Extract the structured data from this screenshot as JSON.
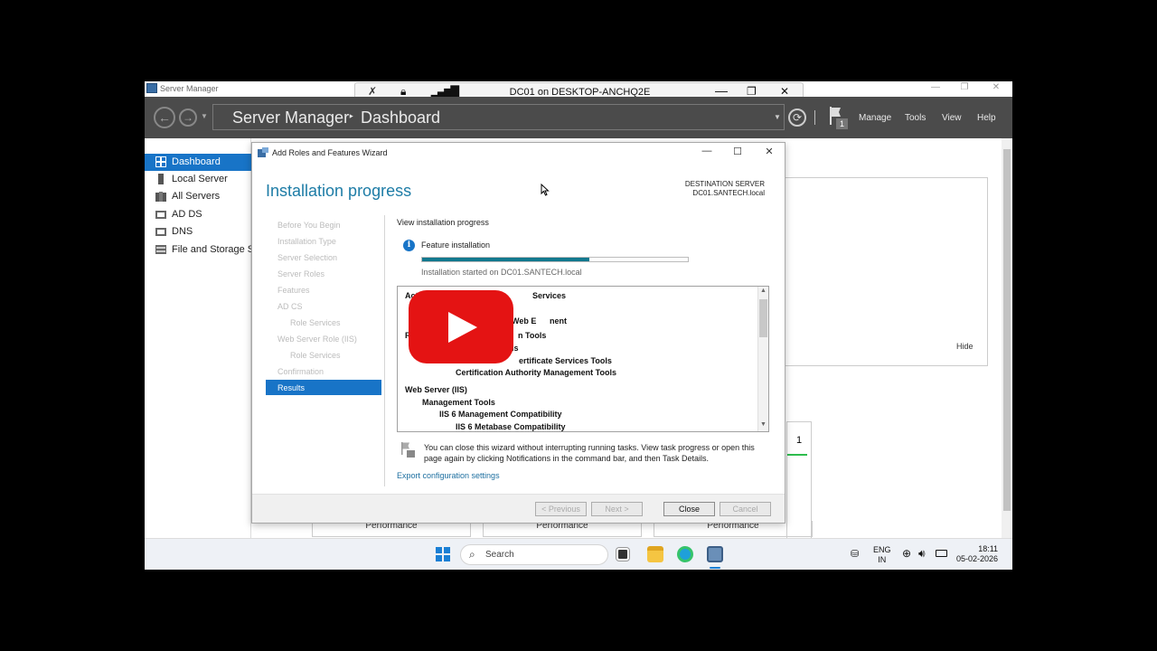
{
  "server_manager": {
    "window_title": "Server Manager",
    "breadcrumb_app": "Server Manager",
    "breadcrumb_sep": "‣",
    "breadcrumb_page": "Dashboard",
    "menu": [
      "Manage",
      "Tools",
      "View",
      "Help"
    ],
    "notification_count": "1",
    "sidebar": [
      {
        "label": "Dashboard",
        "icon": "dashboard-icon",
        "active": true
      },
      {
        "label": "Local Server",
        "icon": "server-icon"
      },
      {
        "label": "All Servers",
        "icon": "servers-icon"
      },
      {
        "label": "AD DS",
        "icon": "ad-ds-icon"
      },
      {
        "label": "DNS",
        "icon": "dns-icon"
      },
      {
        "label": "File and Storage Se",
        "icon": "storage-icon"
      }
    ],
    "hide_label": "Hide",
    "tile_count": "1",
    "performance_labels": [
      "Performance",
      "Performance",
      "Performance"
    ]
  },
  "rdp": {
    "title": "DC01 on DESKTOP-ANCHQ2E"
  },
  "wizard": {
    "title": "Add Roles and Features Wizard",
    "heading": "Installation progress",
    "destination_label": "DESTINATION SERVER",
    "destination_value": "DC01.SANTECH.local",
    "steps": [
      {
        "label": "Before You Begin"
      },
      {
        "label": "Installation Type"
      },
      {
        "label": "Server Selection"
      },
      {
        "label": "Server Roles"
      },
      {
        "label": "Features"
      },
      {
        "label": "AD CS"
      },
      {
        "label": "Role Services",
        "sub": true
      },
      {
        "label": "Web Server Role (IIS)"
      },
      {
        "label": "Role Services",
        "sub": true
      },
      {
        "label": "Confirmation"
      },
      {
        "label": "Results",
        "active": true
      }
    ],
    "view_progress": "View installation progress",
    "feature_installation": "Feature installation",
    "progress_percent": 63,
    "install_started": "Installation started on DC01.SANTECH.local",
    "features": [
      {
        "text": "Acti",
        "indent": 0
      },
      {
        "text": "Services",
        "indent": 0,
        "offset": 149
      },
      {
        "text": "Web E",
        "indent": 0,
        "offset": 126
      },
      {
        "text": "nent",
        "indent": 0,
        "offset": 168
      },
      {
        "text": "R",
        "indent": 0
      },
      {
        "text": "n Tools",
        "indent": 0,
        "offset": 133
      },
      {
        "text": "ls",
        "indent": 0,
        "offset": 126
      },
      {
        "text": "ertificate Services Tools",
        "indent": 0,
        "offset": 134
      },
      {
        "text": "Certification Authority Management Tools",
        "indent": 3
      },
      {
        "text": "Web Server (IIS)",
        "indent": 0
      },
      {
        "text": "Management Tools",
        "indent": 1
      },
      {
        "text": "IIS 6 Management Compatibility",
        "indent": 2
      },
      {
        "text": "IIS 6 Metabase Compatibility",
        "indent": 3
      }
    ],
    "close_note": "You can close this wizard without interrupting running tasks. View task progress or open this page again by clicking Notifications in the command bar, and then Task Details.",
    "export_link": "Export configuration settings",
    "buttons": {
      "previous": "< Previous",
      "next": "Next >",
      "close": "Close",
      "cancel": "Cancel"
    }
  },
  "taskbar": {
    "search_placeholder": "Search",
    "language": "ENG",
    "region": "IN",
    "time": "18:11",
    "date": "05-02-2026"
  },
  "colors": {
    "accent_blue": "#1874c7",
    "heading_teal": "#1d7ca6",
    "progress_fill": "#12788e",
    "youtube_red": "#e41313"
  }
}
